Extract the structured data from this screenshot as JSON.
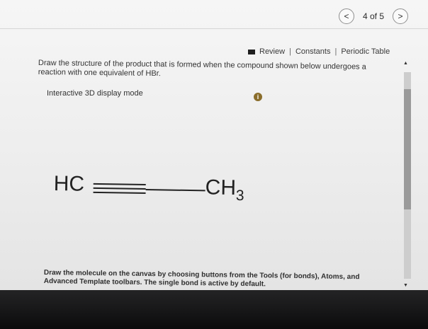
{
  "nav": {
    "prev_label": "<",
    "position_label": "4 of 5",
    "next_label": ">"
  },
  "links": {
    "review": "Review",
    "separator": "|",
    "constants": "Constants",
    "periodic_table": "Periodic Table"
  },
  "question": {
    "text": "Draw the structure of the product that is formed when the compound shown below undergoes a reaction with one equivalent of HBr."
  },
  "display_mode": {
    "label": "Interactive 3D display mode",
    "info_glyph": "i"
  },
  "molecule": {
    "left_group": "HC",
    "right_group_base": "CH",
    "right_group_subscript": "3",
    "bonds": [
      "triple",
      "single"
    ]
  },
  "instructions": {
    "text": "Draw the molecule on the canvas by choosing buttons from the Tools (for bonds), Atoms, and Advanced Template toolbars. The single bond is active by default."
  },
  "scrollbar": {
    "up_glyph": "▲",
    "down_glyph": "▼"
  }
}
